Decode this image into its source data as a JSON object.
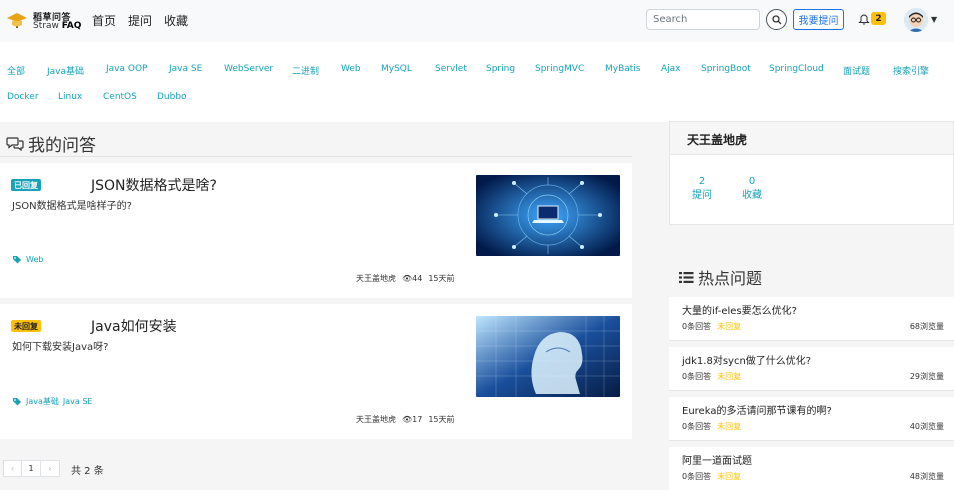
{
  "brand": {
    "line1": "稻草问答",
    "line2_prefix": "Straw ",
    "line2_bold": "FAQ"
  },
  "nav": [
    "首页",
    "提问",
    "收藏"
  ],
  "search": {
    "placeholder": "Search"
  },
  "ask_button": "我要提问",
  "notifications": {
    "count": "2"
  },
  "tags_row1": [
    "全部",
    "Java基础",
    "Java OOP",
    "Java SE",
    "WebServer",
    "二进制",
    "Web",
    "MySQL",
    "Servlet",
    "Spring",
    "SpringMVC",
    "MyBatis",
    "Ajax",
    "SpringBoot",
    "SpringCloud",
    "面试题",
    "搜索引擎"
  ],
  "tags_row2": [
    "Docker",
    "Linux",
    "CentOS",
    "Dubbo"
  ],
  "my_questions": {
    "title": "我的问答",
    "items": [
      {
        "status": "已回复",
        "title": "JSON数据格式是啥?",
        "desc": "JSON数据格式是啥样子的?",
        "tags": [
          "Web"
        ],
        "author": "天王盖地虎",
        "views": "44",
        "time": "15天前"
      },
      {
        "status": "未回复",
        "title": "Java如何安装",
        "desc": "如何下载安装Java呀?",
        "tags": [
          "Java基础",
          "Java SE"
        ],
        "author": "天王盖地虎",
        "views": "17",
        "time": "15天前"
      }
    ]
  },
  "pagination": {
    "prev": "‹",
    "current": "1",
    "next": "›",
    "total": "共 2 条"
  },
  "user": {
    "name": "天王盖地虎",
    "questions_count": "2",
    "questions_label": "提问",
    "favorites_count": "0",
    "favorites_label": "收藏"
  },
  "hot": {
    "title": "热点问题",
    "items": [
      {
        "title": "大量的if-eles要怎么优化?",
        "answers": "0条回答",
        "status": "未回复",
        "views": "68浏览量"
      },
      {
        "title": "jdk1.8对sycn做了什么优化?",
        "answers": "0条回答",
        "status": "未回复",
        "views": "29浏览量"
      },
      {
        "title": "Eureka的多活请问那节课有的啊?",
        "answers": "0条回答",
        "status": "未回复",
        "views": "40浏览量"
      },
      {
        "title": "阿里一道面试题",
        "answers": "0条回答",
        "status": "未回复",
        "views": "48浏览量"
      }
    ]
  },
  "colors": {
    "accent": "#17a2b8",
    "warning": "#ffc107",
    "primary": "#1a73e8"
  }
}
